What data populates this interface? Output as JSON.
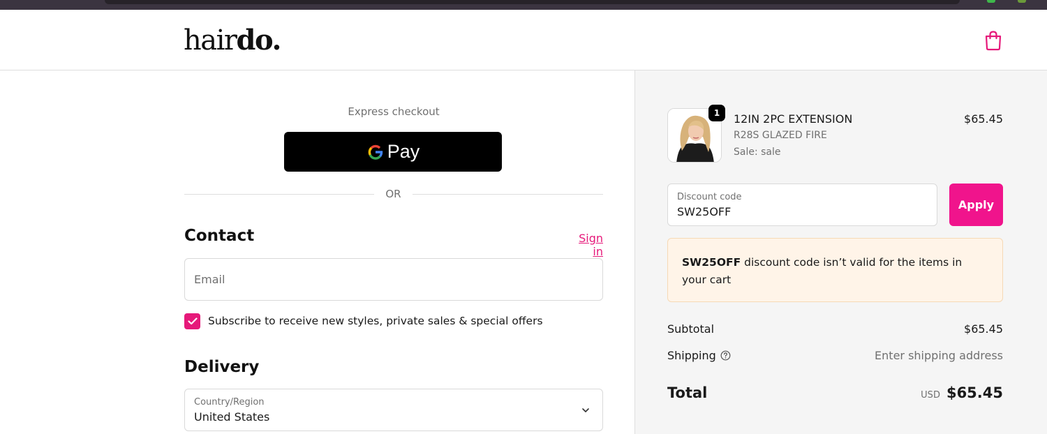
{
  "brand": {
    "logo_regular": "hair",
    "logo_bold": "do.",
    "accent_color": "#f0148c"
  },
  "header": {
    "cart_icon": "shopping-bag-icon"
  },
  "express": {
    "label": "Express checkout",
    "button_text": "Pay"
  },
  "divider": {
    "text": "OR"
  },
  "contact": {
    "title": "Contact",
    "sign_in": "Sign in",
    "email_placeholder": "Email",
    "subscribe_checked": true,
    "subscribe_text": "Subscribe to receive new styles, private sales & special offers"
  },
  "delivery": {
    "title": "Delivery",
    "country_label": "Country/Region",
    "country_value": "United States"
  },
  "summary": {
    "item": {
      "quantity": "1",
      "name": "12IN 2PC EXTENSION",
      "variant": "R28S GLAZED FIRE",
      "sale": "Sale: sale",
      "price": "$65.45"
    },
    "discount": {
      "label": "Discount code",
      "value": "SW25OFF",
      "apply": "Apply"
    },
    "error": {
      "code": "SW25OFF",
      "message": " discount code isn’t valid for the items in your cart"
    },
    "subtotal_label": "Subtotal",
    "subtotal_value": "$65.45",
    "shipping_label": "Shipping",
    "shipping_value": "Enter shipping address",
    "total_label": "Total",
    "currency": "USD",
    "total_value": "$65.45"
  }
}
